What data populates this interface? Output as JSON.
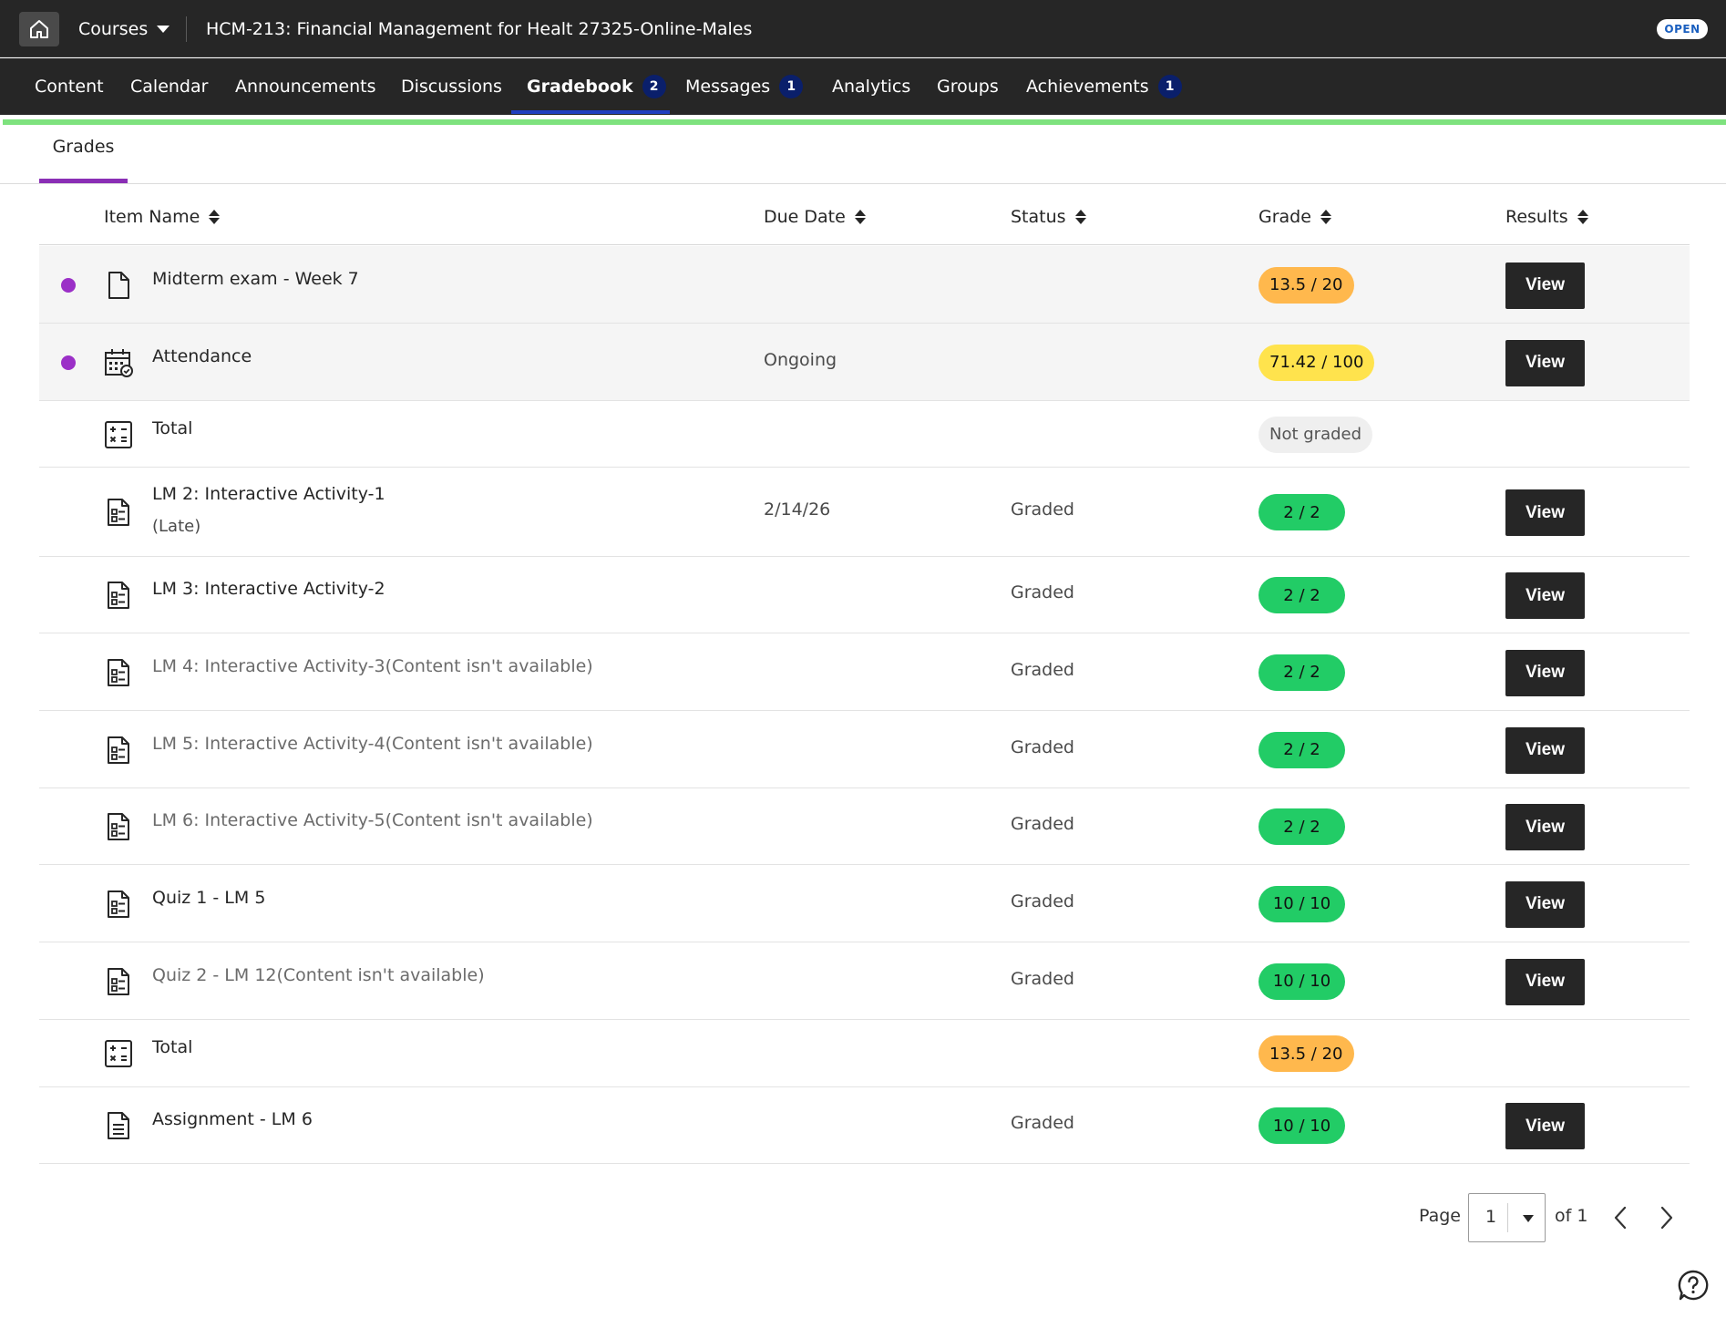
{
  "topbar": {
    "courses_label": "Courses",
    "course_title": "HCM-213: Financial Management for Healt 27325-Online-Males",
    "open_badge": "OPEN"
  },
  "nav": {
    "items": [
      {
        "label": "Content",
        "badge": ""
      },
      {
        "label": "Calendar",
        "badge": ""
      },
      {
        "label": "Announcements",
        "badge": ""
      },
      {
        "label": "Discussions",
        "badge": ""
      },
      {
        "label": "Gradebook",
        "badge": "2"
      },
      {
        "label": "Messages",
        "badge": "1"
      },
      {
        "label": "Analytics",
        "badge": ""
      },
      {
        "label": "Groups",
        "badge": ""
      },
      {
        "label": "Achievements",
        "badge": "1"
      }
    ],
    "active": "Gradebook"
  },
  "subtabs": {
    "grades_label": "Grades"
  },
  "table": {
    "headers": {
      "item_name": "Item Name",
      "due_date": "Due Date",
      "status": "Status",
      "grade": "Grade",
      "results": "Results"
    },
    "rows": [
      {
        "name": "Midterm exam - Week 7",
        "sub": "",
        "due": "",
        "status": "",
        "grade": "13.5 / 20",
        "grade_color": "#ffb84d",
        "result": "View",
        "unread": true,
        "icon": "document-icon",
        "available": true
      },
      {
        "name": "Attendance",
        "sub": "",
        "due": "Ongoing",
        "status": "",
        "grade": "71.42 / 100",
        "grade_color": "#ffe34d",
        "result": "View",
        "unread": true,
        "icon": "attendance-calendar-icon",
        "available": true
      },
      {
        "name": "Total",
        "sub": "",
        "due": "",
        "status": "",
        "grade": "Not graded",
        "grade_color": "#efefef",
        "result": "",
        "unread": false,
        "icon": "calculator-icon",
        "available": true
      },
      {
        "name": "LM 2: Interactive Activity-1",
        "sub": "(Late)",
        "due": "2/14/26",
        "status": "Graded",
        "grade": "2 / 2",
        "grade_color": "#22cc66",
        "result": "View",
        "unread": false,
        "icon": "test-icon",
        "available": true
      },
      {
        "name": "LM 3: Interactive Activity-2",
        "sub": "",
        "due": "",
        "status": "Graded",
        "grade": "2 / 2",
        "grade_color": "#22cc66",
        "result": "View",
        "unread": false,
        "icon": "test-icon",
        "available": true
      },
      {
        "name": "LM 4: Interactive Activity-3(Content isn't available)",
        "sub": "",
        "due": "",
        "status": "Graded",
        "grade": "2 / 2",
        "grade_color": "#22cc66",
        "result": "View",
        "unread": false,
        "icon": "test-icon",
        "available": false
      },
      {
        "name": "LM 5: Interactive Activity-4(Content isn't available)",
        "sub": "",
        "due": "",
        "status": "Graded",
        "grade": "2 / 2",
        "grade_color": "#22cc66",
        "result": "View",
        "unread": false,
        "icon": "test-icon",
        "available": false
      },
      {
        "name": "LM 6: Interactive Activity-5(Content isn't available)",
        "sub": "",
        "due": "",
        "status": "Graded",
        "grade": "2 / 2",
        "grade_color": "#22cc66",
        "result": "View",
        "unread": false,
        "icon": "test-icon",
        "available": false
      },
      {
        "name": "Quiz 1 - LM 5",
        "sub": "",
        "due": "",
        "status": "Graded",
        "grade": "10 / 10",
        "grade_color": "#22cc66",
        "result": "View",
        "unread": false,
        "icon": "test-icon",
        "available": true
      },
      {
        "name": "Quiz 2 - LM 12(Content isn't available)",
        "sub": "",
        "due": "",
        "status": "Graded",
        "grade": "10 / 10",
        "grade_color": "#22cc66",
        "result": "View",
        "unread": false,
        "icon": "test-icon",
        "available": false
      },
      {
        "name": "Total",
        "sub": "",
        "due": "",
        "status": "",
        "grade": "13.5 / 20",
        "grade_color": "#ffb84d",
        "result": "",
        "unread": false,
        "icon": "calculator-icon",
        "available": true
      },
      {
        "name": "Assignment - LM 6",
        "sub": "",
        "due": "",
        "status": "Graded",
        "grade": "10 / 10",
        "grade_color": "#22cc66",
        "result": "View",
        "unread": false,
        "icon": "assignment-icon",
        "available": true
      }
    ]
  },
  "pagination": {
    "page_label": "Page",
    "current_page": "1",
    "of_label": "of 1"
  },
  "colors": {
    "accent_purple": "#9b30c7",
    "nav_bg": "#262626",
    "progress_green": "#7ee27e",
    "badge_navy": "#0a1f6b"
  }
}
